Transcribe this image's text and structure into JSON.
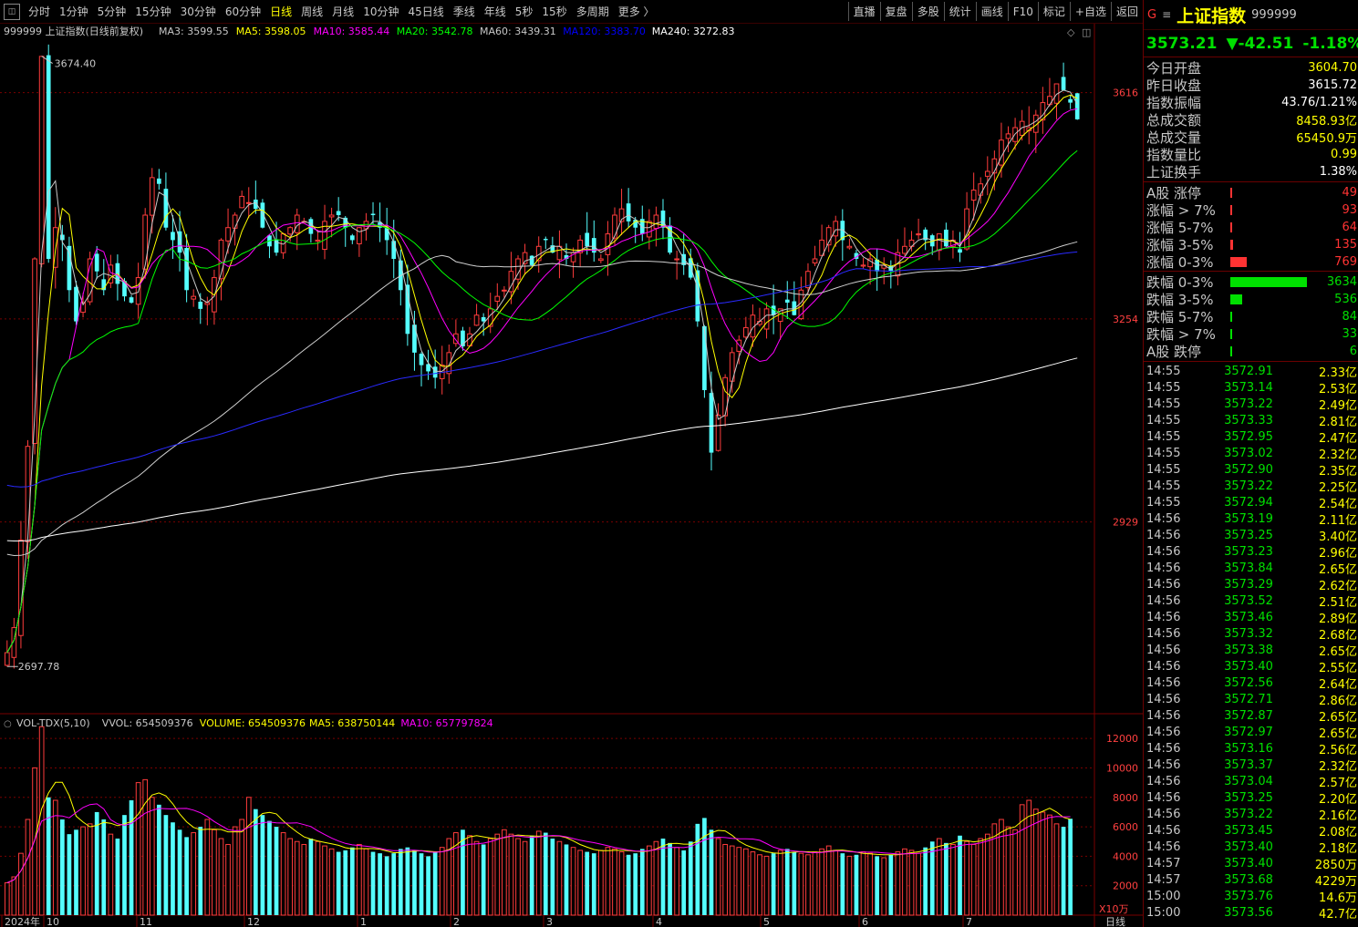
{
  "toolbar": {
    "periods": [
      {
        "label": "分时",
        "active": false
      },
      {
        "label": "1分钟",
        "active": false
      },
      {
        "label": "5分钟",
        "active": false
      },
      {
        "label": "15分钟",
        "active": false
      },
      {
        "label": "30分钟",
        "active": false
      },
      {
        "label": "60分钟",
        "active": false
      },
      {
        "label": "日线",
        "active": true
      },
      {
        "label": "周线",
        "active": false
      },
      {
        "label": "月线",
        "active": false
      },
      {
        "label": "10分钟",
        "active": false
      },
      {
        "label": "45日线",
        "active": false
      },
      {
        "label": "季线",
        "active": false
      },
      {
        "label": "年线",
        "active": false
      },
      {
        "label": "5秒",
        "active": false
      },
      {
        "label": "15秒",
        "active": false
      },
      {
        "label": "多周期",
        "active": false
      },
      {
        "label": "更多 〉",
        "active": false
      }
    ],
    "buttons": [
      "直播",
      "复盘",
      "多股",
      "统计",
      "画线",
      "F10",
      "标记",
      "+自选",
      "返回"
    ]
  },
  "main_chart": {
    "legend_prefix": "999999 上证指数(日线前复权)",
    "ma_legend": [
      {
        "text": "MA3: 3599.55",
        "color": "#c8c8c8"
      },
      {
        "text": "MA5: 3598.05",
        "color": "#ffff00"
      },
      {
        "text": "MA10: 3585.44",
        "color": "#ff00ff"
      },
      {
        "text": "MA20: 3542.78",
        "color": "#00ff00"
      },
      {
        "text": "MA60: 3439.31",
        "color": "#c8c8c8"
      },
      {
        "text": "MA120: 3383.70",
        "color": "#0000ff"
      },
      {
        "text": "MA240: 3272.83",
        "color": "#ffffff"
      }
    ],
    "high_label": "3674.40",
    "low_label": "2697.78",
    "y_ticks": [
      "3616",
      "3254",
      "2929"
    ]
  },
  "volume_chart": {
    "legend": [
      {
        "text": "VOL-TDX(5,10)",
        "color": "#c8c8c8"
      },
      {
        "text": "VVOL: 654509376",
        "color": "#c8c8c8"
      },
      {
        "text": "VOLUME: 654509376",
        "color": "#ffff00"
      },
      {
        "text": "MA5: 638750144",
        "color": "#ffff00"
      },
      {
        "text": "MA10: 657797824",
        "color": "#ff00ff"
      }
    ],
    "y_ticks": [
      "12000",
      "10000",
      "8000",
      "6000",
      "4000",
      "2000"
    ],
    "unit": "X10万"
  },
  "x_axis": {
    "labels": [
      "2024年",
      "10",
      "11",
      "12",
      "1",
      "2",
      "3",
      "4",
      "5",
      "6",
      "7"
    ],
    "period_label": "日线"
  },
  "chart_data": {
    "type": "candlestick",
    "price_range": [
      2697.78,
      3674.4
    ],
    "marked_prices": {
      "high": 3674.4,
      "low": 2697.78
    },
    "last": {
      "ma3": 3599.55,
      "ma5": 3598.05,
      "ma10": 3585.44,
      "ma20": 3542.78,
      "ma60": 3439.31,
      "ma120": 3383.7,
      "ma240": 3272.83
    },
    "volume_last": {
      "vvol": 654509376,
      "volume": 654509376,
      "ma5": 638750144,
      "ma10": 657797824
    },
    "volume_unit": "X10万",
    "volume_range": [
      0,
      12000
    ],
    "x_labels": [
      "2024年",
      "10",
      "11",
      "12",
      "1",
      "2",
      "3",
      "4",
      "5",
      "6",
      "7"
    ],
    "close_path": [
      2720,
      2760,
      2900,
      3050,
      3350,
      3674,
      3350,
      3400,
      3380,
      3300,
      3250,
      3280,
      3350,
      3330,
      3300,
      3340,
      3310,
      3290,
      3280,
      3320,
      3420,
      3480,
      3470,
      3400,
      3380,
      3360,
      3300,
      3290,
      3270,
      3280,
      3320,
      3380,
      3400,
      3420,
      3450,
      3440,
      3430,
      3400,
      3370,
      3360,
      3390,
      3400,
      3420,
      3410,
      3390,
      3380,
      3410,
      3420,
      3420,
      3400,
      3380,
      3400,
      3410,
      3420,
      3400,
      3380,
      3350,
      3300,
      3230,
      3200,
      3180,
      3170,
      3160,
      3180,
      3200,
      3230,
      3210,
      3230,
      3260,
      3250,
      3270,
      3290,
      3300,
      3330,
      3350,
      3360,
      3340,
      3370,
      3380,
      3360,
      3370,
      3350,
      3360,
      3380,
      3370,
      3360,
      3350,
      3390,
      3420,
      3430,
      3410,
      3400,
      3390,
      3410,
      3420,
      3400,
      3360,
      3350,
      3340,
      3320,
      3250,
      3140,
      3040,
      3100,
      3160,
      3200,
      3220,
      3240,
      3260,
      3250,
      3270,
      3260,
      3270,
      3280,
      3260,
      3300,
      3330,
      3350,
      3380,
      3400,
      3410,
      3380,
      3370,
      3350,
      3340,
      3350,
      3330,
      3340,
      3330,
      3360,
      3370,
      3380,
      3390,
      3380,
      3370,
      3390,
      3370,
      3380,
      3360,
      3430,
      3460,
      3470,
      3490,
      3510,
      3540,
      3550,
      3560,
      3570,
      3560,
      3580,
      3600,
      3610,
      3630,
      3620,
      3600,
      3573.21
    ],
    "volume_path": [
      2200,
      2600,
      4200,
      6500,
      10000,
      12800,
      8000,
      7800,
      6500,
      5500,
      5800,
      6000,
      6200,
      7000,
      6500,
      5500,
      5200,
      6800,
      7800,
      9000,
      9200,
      8000,
      7500,
      6800,
      6300,
      5800,
      5300,
      5600,
      6000,
      6500,
      5800,
      5200,
      4800,
      6000,
      6500,
      8000,
      7200,
      6800,
      6400,
      6000,
      5600,
      5200,
      5000,
      4800,
      5200,
      5000,
      4700,
      4500,
      4300,
      4400,
      4600,
      4800,
      4500,
      4300,
      4200,
      4000,
      4200,
      4500,
      4600,
      4400,
      4200,
      4000,
      4300,
      4600,
      5200,
      5600,
      5800,
      5400,
      5000,
      4800,
      5200,
      5500,
      5800,
      5500,
      5200,
      5000,
      5400,
      5700,
      5600,
      5200,
      5000,
      4800,
      4600,
      4400,
      4300,
      4200,
      4400,
      4600,
      4500,
      4300,
      4100,
      4200,
      4500,
      4700,
      5000,
      5200,
      4900,
      4600,
      4400,
      5000,
      6200,
      6600,
      5800,
      5200,
      4800,
      4700,
      4600,
      4500,
      4300,
      4100,
      4000,
      4200,
      4400,
      4500,
      4300,
      4200,
      4100,
      4300,
      4500,
      4700,
      4400,
      4200,
      4000,
      4100,
      4300,
      4200,
      4000,
      3900,
      4100,
      4300,
      4500,
      4400,
      4200,
      4600,
      5000,
      5200,
      4900,
      4800,
      5400,
      5000,
      4800,
      5200,
      5500,
      6200,
      6500,
      6000,
      5800,
      7500,
      7800,
      7200,
      7000,
      6800,
      6200,
      6000,
      6545
    ]
  },
  "panel": {
    "g_label": "G",
    "eq_label": "≡",
    "index_name": "上证指数",
    "index_code": "999999",
    "price": "3573.21",
    "change": "▼-42.51",
    "change_pct": "-1.18%",
    "stats": [
      {
        "label": "今日开盘",
        "value": "3604.70",
        "color": "#ffff00"
      },
      {
        "label": "昨日收盘",
        "value": "3615.72",
        "color": "#ffffff"
      },
      {
        "label": "指数振幅",
        "value": "43.76/1.21%",
        "color": "#ffffff"
      },
      {
        "label": "总成交额",
        "value": "8458.93亿",
        "color": "#ffff00"
      },
      {
        "label": "总成交量",
        "value": "65450.9万",
        "color": "#ffff00"
      },
      {
        "label": "指数量比",
        "value": "0.99",
        "color": "#ffff00"
      },
      {
        "label": "上证换手",
        "value": "1.38%",
        "color": "#ffffff"
      }
    ],
    "up": [
      {
        "label": "A股 涨停",
        "count": "49",
        "frac": 0.01
      },
      {
        "label": "涨幅 > 7%",
        "count": "93",
        "frac": 0.02
      },
      {
        "label": "涨幅 5-7%",
        "count": "64",
        "frac": 0.015
      },
      {
        "label": "涨幅 3-5%",
        "count": "135",
        "frac": 0.04
      },
      {
        "label": "涨幅 0-3%",
        "count": "769",
        "frac": 0.21
      }
    ],
    "down": [
      {
        "label": "跌幅 0-3%",
        "count": "3634",
        "frac": 1.0
      },
      {
        "label": "跌幅 3-5%",
        "count": "536",
        "frac": 0.15
      },
      {
        "label": "跌幅 5-7%",
        "count": "84",
        "frac": 0.02
      },
      {
        "label": "跌幅 > 7%",
        "count": "33",
        "frac": 0.01
      },
      {
        "label": "A股 跌停",
        "count": "6",
        "frac": 0.005
      }
    ],
    "ticks": [
      {
        "time": "14:55",
        "price": "3572.91",
        "vol": "2.33亿"
      },
      {
        "time": "14:55",
        "price": "3573.14",
        "vol": "2.53亿"
      },
      {
        "time": "14:55",
        "price": "3573.22",
        "vol": "2.49亿"
      },
      {
        "time": "14:55",
        "price": "3573.33",
        "vol": "2.81亿"
      },
      {
        "time": "14:55",
        "price": "3572.95",
        "vol": "2.47亿"
      },
      {
        "time": "14:55",
        "price": "3573.02",
        "vol": "2.32亿"
      },
      {
        "time": "14:55",
        "price": "3572.90",
        "vol": "2.35亿"
      },
      {
        "time": "14:55",
        "price": "3573.22",
        "vol": "2.25亿"
      },
      {
        "time": "14:55",
        "price": "3572.94",
        "vol": "2.54亿"
      },
      {
        "time": "14:56",
        "price": "3573.19",
        "vol": "2.11亿"
      },
      {
        "time": "14:56",
        "price": "3573.25",
        "vol": "3.40亿"
      },
      {
        "time": "14:56",
        "price": "3573.23",
        "vol": "2.96亿"
      },
      {
        "time": "14:56",
        "price": "3573.84",
        "vol": "2.65亿"
      },
      {
        "time": "14:56",
        "price": "3573.29",
        "vol": "2.62亿"
      },
      {
        "time": "14:56",
        "price": "3573.52",
        "vol": "2.51亿"
      },
      {
        "time": "14:56",
        "price": "3573.46",
        "vol": "2.89亿"
      },
      {
        "time": "14:56",
        "price": "3573.32",
        "vol": "2.68亿"
      },
      {
        "time": "14:56",
        "price": "3573.38",
        "vol": "2.65亿"
      },
      {
        "time": "14:56",
        "price": "3573.40",
        "vol": "2.55亿"
      },
      {
        "time": "14:56",
        "price": "3572.56",
        "vol": "2.64亿"
      },
      {
        "time": "14:56",
        "price": "3572.71",
        "vol": "2.86亿"
      },
      {
        "time": "14:56",
        "price": "3572.87",
        "vol": "2.65亿"
      },
      {
        "time": "14:56",
        "price": "3572.97",
        "vol": "2.65亿"
      },
      {
        "time": "14:56",
        "price": "3573.16",
        "vol": "2.56亿"
      },
      {
        "time": "14:56",
        "price": "3573.37",
        "vol": "2.32亿"
      },
      {
        "time": "14:56",
        "price": "3573.04",
        "vol": "2.57亿"
      },
      {
        "time": "14:56",
        "price": "3573.25",
        "vol": "2.20亿"
      },
      {
        "time": "14:56",
        "price": "3573.22",
        "vol": "2.16亿"
      },
      {
        "time": "14:56",
        "price": "3573.45",
        "vol": "2.08亿"
      },
      {
        "time": "14:56",
        "price": "3573.40",
        "vol": "2.18亿"
      },
      {
        "time": "14:57",
        "price": "3573.40",
        "vol": "2850万"
      },
      {
        "time": "14:57",
        "price": "3573.68",
        "vol": "4229万"
      },
      {
        "time": "15:00",
        "price": "3573.76",
        "vol": "14.6万"
      },
      {
        "time": "15:00",
        "price": "3573.56",
        "vol": "42.7亿"
      }
    ]
  }
}
